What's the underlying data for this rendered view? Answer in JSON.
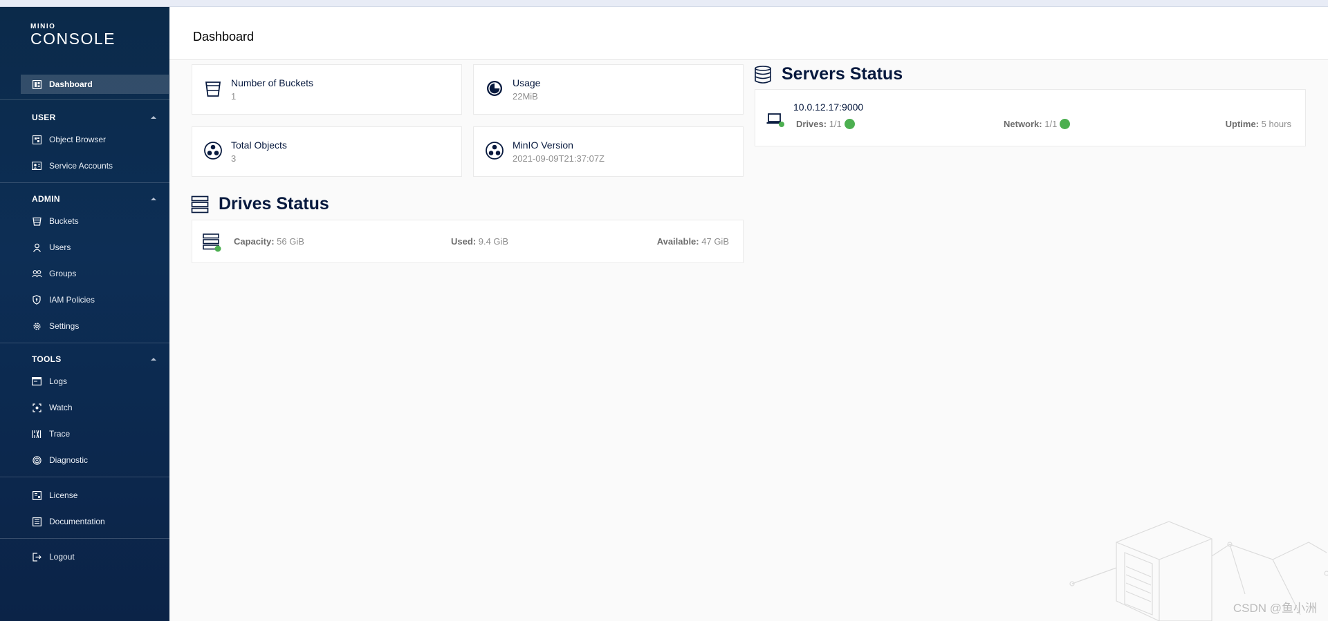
{
  "brand": {
    "top": "MINIO",
    "bottom": "CONSOLE"
  },
  "header": {
    "title": "Dashboard"
  },
  "sidebar": {
    "dashboard": "Dashboard",
    "user_section": "USER",
    "user_items": [
      "Object Browser",
      "Service Accounts"
    ],
    "admin_section": "ADMIN",
    "admin_items": [
      "Buckets",
      "Users",
      "Groups",
      "IAM Policies",
      "Settings"
    ],
    "tools_section": "TOOLS",
    "tools_items": [
      "Logs",
      "Watch",
      "Trace",
      "Diagnostic"
    ],
    "extra_items": [
      "License",
      "Documentation"
    ],
    "logout": "Logout"
  },
  "stats": {
    "buckets": {
      "label": "Number of Buckets",
      "value": "1"
    },
    "usage": {
      "label": "Usage",
      "value": "22MiB"
    },
    "objects": {
      "label": "Total Objects",
      "value": "3"
    },
    "version": {
      "label": "MinIO Version",
      "value": "2021-09-09T21:37:07Z"
    }
  },
  "drives": {
    "title": "Drives Status",
    "capacity_label": "Capacity:",
    "capacity_value": "56 GiB",
    "used_label": "Used:",
    "used_value": "9.4 GiB",
    "available_label": "Available:",
    "available_value": "47 GiB"
  },
  "servers": {
    "title": "Servers Status",
    "endpoint": "10.0.12.17:9000",
    "drives_label": "Drives:",
    "drives_value": "1/1",
    "network_label": "Network:",
    "network_value": "1/1",
    "uptime_label": "Uptime:",
    "uptime_value": "5 hours"
  },
  "watermark": "CSDN @鱼小洲",
  "colors": {
    "sidebar": "#0d2e55",
    "accent_green": "#4caf50",
    "title": "#07193e"
  },
  "icons": {
    "dashboard": "dashboard-icon",
    "object_browser": "object-browser-icon",
    "service_accounts": "service-accounts-icon",
    "buckets": "bucket-icon",
    "users": "user-icon",
    "groups": "groups-icon",
    "iam": "shield-icon",
    "settings": "gear-icon",
    "logs": "logs-icon",
    "watch": "watch-icon",
    "trace": "trace-icon",
    "diagnostic": "diagnostic-icon",
    "license": "license-icon",
    "documentation": "documentation-icon",
    "logout": "logout-icon"
  }
}
